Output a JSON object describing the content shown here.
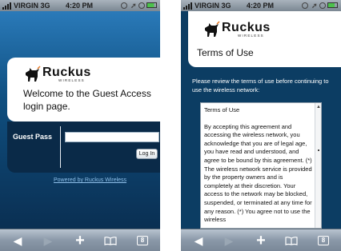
{
  "status_bar": {
    "carrier": "VIRGIN 3G",
    "time": "4:20 PM"
  },
  "brand": {
    "wordmark": "Ruckus",
    "tagline": "WIRELESS",
    "accent": "#0c3d63"
  },
  "left_screen": {
    "welcome": "Welcome to the Guest Access login page.",
    "guest_pass_label": "Guest Pass",
    "guest_pass_value": "",
    "login_button": "Log In",
    "powered_by": "Powered by Ruckus Wireless"
  },
  "right_screen": {
    "title": "Terms of Use",
    "intro": "Please review the terms of use before continuing to use the wireless network:",
    "box_heading": "Terms of Use",
    "box_body": "By accepting this agreement and accessing the wireless network, you acknowledge that you are of legal age, you have read and understood, and agree to be bound by this agreement. (*) The wireless network service is provided by the property owners and is completely at their discretion. Your access to the network may be blocked, suspended, or terminated at any time for any reason. (*) You agree not to use the wireless"
  },
  "toolbar": {
    "icons": [
      "back-icon",
      "forward-icon",
      "add-bookmark-icon",
      "bookmarks-icon",
      "pages-icon"
    ],
    "pages_count": "8"
  }
}
